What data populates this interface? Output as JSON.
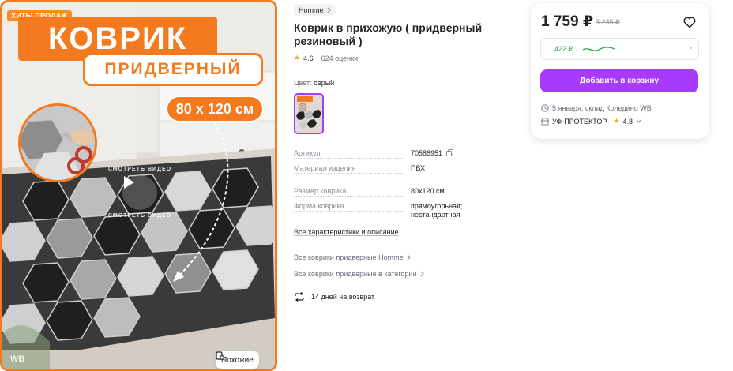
{
  "gallery": {
    "hit_badge": "ХИТЫ ПРОДАЖ",
    "banner_title": "КОВРИК",
    "banner_subtitle": "ПРИДВЕРНЫЙ",
    "size_label": "80 x 120 см",
    "video_label_top": "СМОТРЕТЬ ВИДЕО",
    "video_label_bottom": "СМОТРЕТЬ ВИДЕО",
    "watermark": "WB",
    "similar_button": "Похожие"
  },
  "product": {
    "brand": "Homme",
    "title": "Коврик в прихожую ( придверный резиновый )",
    "rating": "4.6",
    "reviews": "624 оценки",
    "color_label": "Цвет:",
    "color_value": "серый",
    "specs": [
      {
        "key": "Артикул",
        "value": "70588951"
      },
      {
        "key": "Материал изделия",
        "value": "ПВХ"
      },
      {
        "key": "Размер коврика",
        "value": "80x120 см"
      },
      {
        "key": "Форма коврика",
        "value": "прямоугольная; нестандартная"
      }
    ],
    "all_specs_link": "Все характеристики и описание",
    "links": [
      "Все коврики придверные Homme",
      "Все коврики придверные в категории"
    ],
    "return_text": "14 дней на возврат"
  },
  "purchase": {
    "price": "1 759 ₽",
    "old_price": "3 235 ₽",
    "wallet_amount": "422 ₽",
    "add_to_cart": "Добавить в корзину",
    "delivery": "5 января, склад Коледино WB",
    "seller": "УФ-ПРОТЕКТОР",
    "seller_rating": "4.8"
  },
  "colors": {
    "accent_orange": "#f37a1f",
    "brand_purple": "#a73afd",
    "wallet_green": "#1fa04b"
  }
}
